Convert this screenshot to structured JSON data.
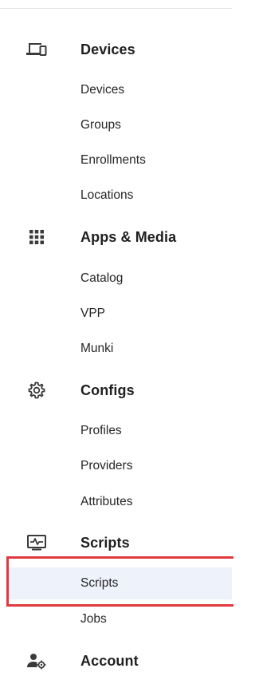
{
  "sections": [
    {
      "label": "Devices",
      "icon": "devices-icon",
      "items": [
        {
          "label": "Devices"
        },
        {
          "label": "Groups"
        },
        {
          "label": "Enrollments"
        },
        {
          "label": "Locations"
        }
      ]
    },
    {
      "label": "Apps & Media",
      "icon": "apps-grid-icon",
      "items": [
        {
          "label": "Catalog"
        },
        {
          "label": "VPP"
        },
        {
          "label": "Munki"
        }
      ]
    },
    {
      "label": "Configs",
      "icon": "gear-icon",
      "items": [
        {
          "label": "Profiles"
        },
        {
          "label": "Providers"
        },
        {
          "label": "Attributes"
        }
      ]
    },
    {
      "label": "Scripts",
      "icon": "script-monitor-icon",
      "items": [
        {
          "label": "Scripts",
          "active": true
        },
        {
          "label": "Jobs"
        }
      ]
    },
    {
      "label": "Account",
      "icon": "account-settings-icon",
      "items": []
    }
  ],
  "colors": {
    "active_background": "#eef2fb",
    "highlight_border": "#e0393e",
    "icon_color": "#3a3a3a"
  }
}
